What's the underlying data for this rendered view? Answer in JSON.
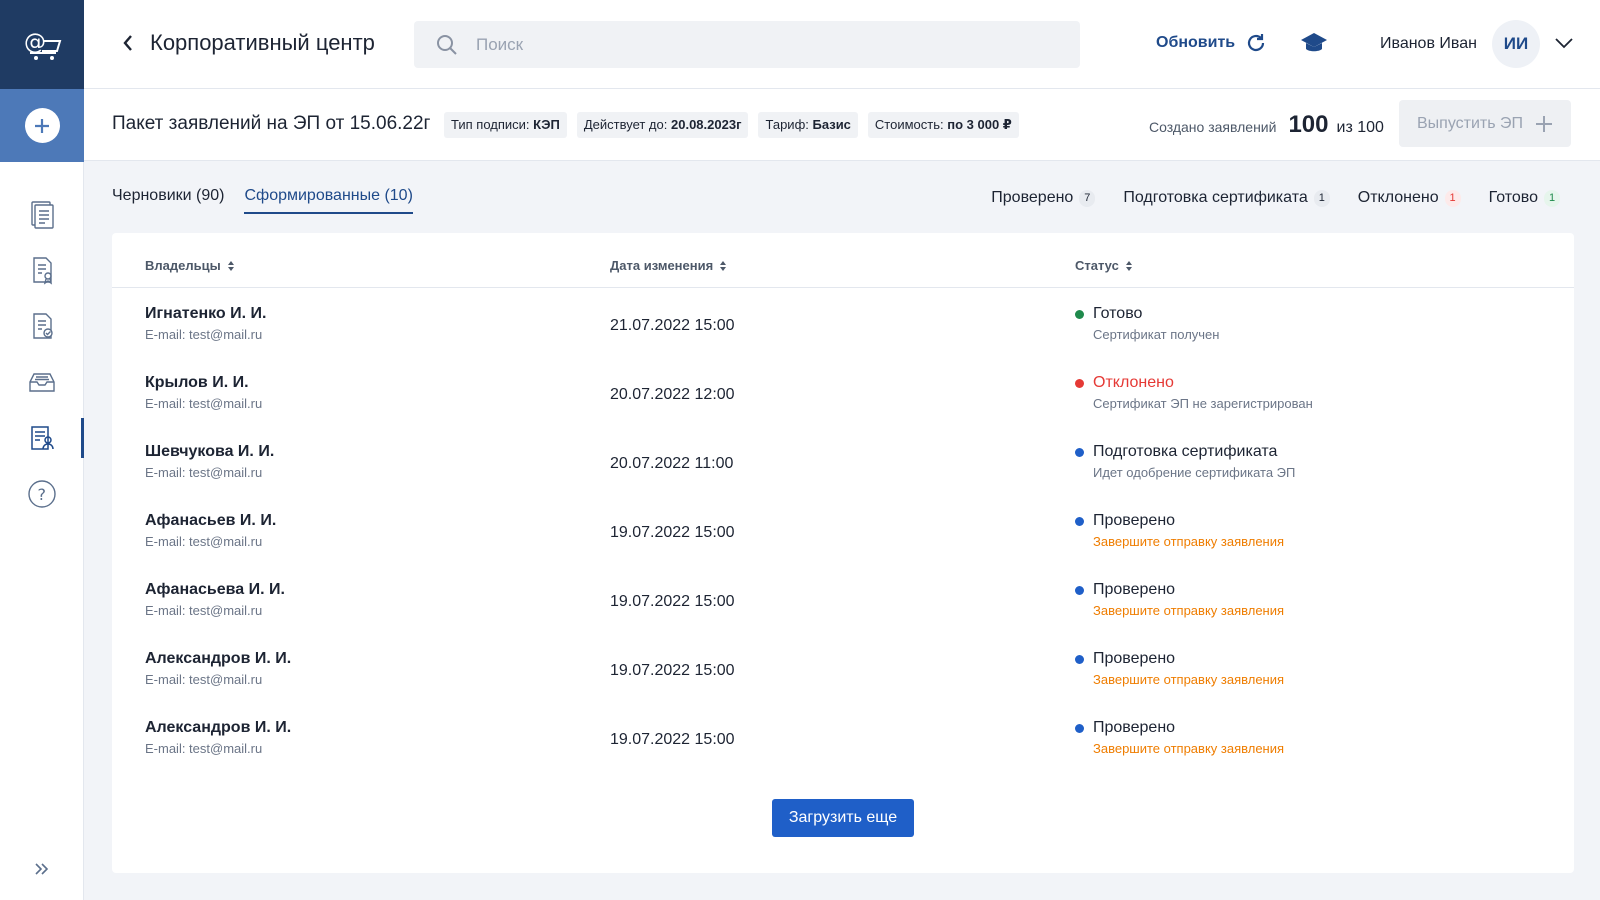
{
  "header": {
    "title": "Корпоративный центр",
    "search_placeholder": "Поиск",
    "refresh_label": "Обновить",
    "user_name": "Иванов Иван",
    "user_initials": "ИИ"
  },
  "package": {
    "title": "Пакет заявлений на ЭП от 15.06.22г",
    "chips": [
      {
        "label": "Тип подписи:",
        "value": "КЭП"
      },
      {
        "label": "Действует до:",
        "value": "20.08.2023г"
      },
      {
        "label": "Тариф:",
        "value": "Базис"
      },
      {
        "label": "Стоимость:",
        "value": "по 3 000 ₽"
      }
    ],
    "created_label": "Создано заявлений",
    "created_count": "100",
    "created_of": "из 100",
    "issue_button": "Выпустить ЭП"
  },
  "tabs": [
    {
      "label": "Черновики (90)"
    },
    {
      "label": "Сформированные (10)"
    }
  ],
  "counters": [
    {
      "label": "Проверено",
      "count": "7"
    },
    {
      "label": "Подготовка сертификата",
      "count": "1"
    },
    {
      "label": "Отклонено",
      "count": "1"
    },
    {
      "label": "Готово",
      "count": "1"
    }
  ],
  "table": {
    "columns": [
      "Владельцы",
      "Дата изменения",
      "Статус"
    ],
    "rows": [
      {
        "name": "Игнатенко И. И.",
        "email": "E-mail: test@mail.ru",
        "date": "21.07.2022 15:00",
        "status": "Готово",
        "status_sub": "Сертификат получен",
        "status_color": "#1f8a4c",
        "sub_color": "#6b7587"
      },
      {
        "name": "Крылов И. И.",
        "email": "E-mail: test@mail.ru",
        "date": "20.07.2022 12:00",
        "status": "Отклонено",
        "status_sub": "Сертификат ЭП не зарегистрирован",
        "status_color": "#e53935",
        "sub_color": "#6b7587"
      },
      {
        "name": "Шевчукова И. И.",
        "email": "E-mail: test@mail.ru",
        "date": "20.07.2022 11:00",
        "status": "Подготовка сертификата",
        "status_sub": "Идет одобрение сертификата ЭП",
        "status_color": "#1f5fc8",
        "sub_color": "#6b7587"
      },
      {
        "name": "Афанасьев И. И.",
        "email": "E-mail: test@mail.ru",
        "date": "19.07.2022 15:00",
        "status": "Проверено",
        "status_sub": "Завершите отправку заявления",
        "status_color": "#1f5fc8",
        "sub_color": "#ef7d00"
      },
      {
        "name": "Афанасьева И. И.",
        "email": "E-mail: test@mail.ru",
        "date": "19.07.2022 15:00",
        "status": "Проверено",
        "status_sub": "Завершите отправку заявления",
        "status_color": "#1f5fc8",
        "sub_color": "#ef7d00"
      },
      {
        "name": "Александров И. И.",
        "email": "E-mail: test@mail.ru",
        "date": "19.07.2022 15:00",
        "status": "Проверено",
        "status_sub": "Завершите отправку заявления",
        "status_color": "#1f5fc8",
        "sub_color": "#ef7d00"
      },
      {
        "name": "Александров И. И.",
        "email": "E-mail: test@mail.ru",
        "date": "19.07.2022 15:00",
        "status": "Проверено",
        "status_sub": "Завершите отправку заявления",
        "status_color": "#1f5fc8",
        "sub_color": "#ef7d00"
      }
    ],
    "load_more": "Загрузить еще"
  },
  "sidebar": {
    "icons": [
      "documents-icon",
      "certificate-doc-icon",
      "checked-doc-icon",
      "archive-icon",
      "request-doc-icon",
      "help-icon"
    ]
  }
}
